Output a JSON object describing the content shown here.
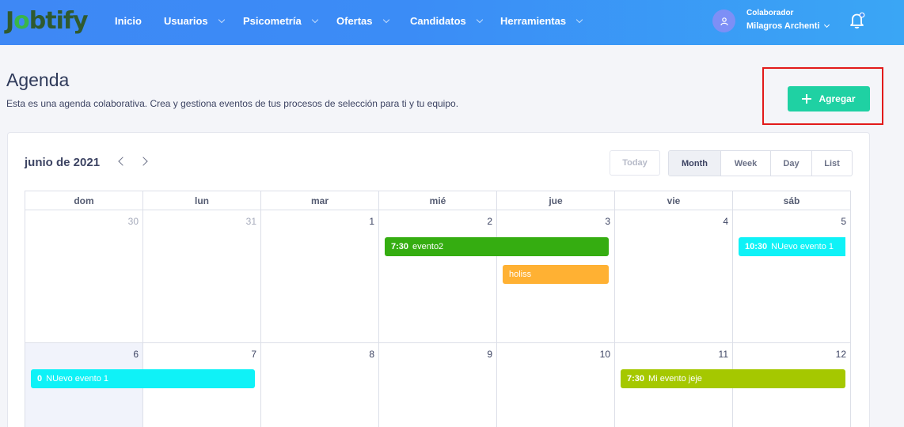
{
  "brand": {
    "logo_a": "J",
    "logo_b": "o",
    "logo_c": "btify"
  },
  "nav": [
    {
      "label": "Inicio"
    },
    {
      "label": "Usuarios"
    },
    {
      "label": "Psicometría"
    },
    {
      "label": "Ofertas"
    },
    {
      "label": "Candidatos"
    },
    {
      "label": "Herramientas"
    }
  ],
  "user": {
    "role": "Colaborador",
    "name": "Milagros Archenti"
  },
  "page": {
    "title": "Agenda",
    "subtitle": "Esta es una agenda colaborativa. Crea y gestiona eventos de tus procesos de selección para ti y tu equipo.",
    "add_label": "Agregar"
  },
  "calendar": {
    "month_label": "junio de 2021",
    "today_label": "Today",
    "views": [
      "Month",
      "Week",
      "Day",
      "List"
    ],
    "active_view": "Month",
    "weekdays": [
      "dom",
      "lun",
      "mar",
      "mié",
      "jue",
      "vie",
      "sáb"
    ],
    "weeks": [
      [
        "30",
        "31",
        "1",
        "2",
        "3",
        "4",
        "5"
      ],
      [
        "6",
        "7",
        "8",
        "9",
        "10",
        "11",
        "12"
      ]
    ],
    "events": [
      {
        "time": "7:30",
        "title": "evento2",
        "color": "#35ad11"
      },
      {
        "time": "",
        "title": "holiss",
        "color": "#ffb133"
      },
      {
        "time": "10:30",
        "title": "NUevo evento 1",
        "color": "#0ff2f7"
      },
      {
        "time": "0",
        "title": "NUevo evento 1",
        "color": "#0ff2f7"
      },
      {
        "time": "7:30",
        "title": "Mi evento jeje",
        "color": "#a5c800"
      }
    ]
  },
  "colors": {
    "topbar": "#3b8cf6",
    "accent": "#1fd1a3",
    "highlight": "#e21a1a"
  }
}
